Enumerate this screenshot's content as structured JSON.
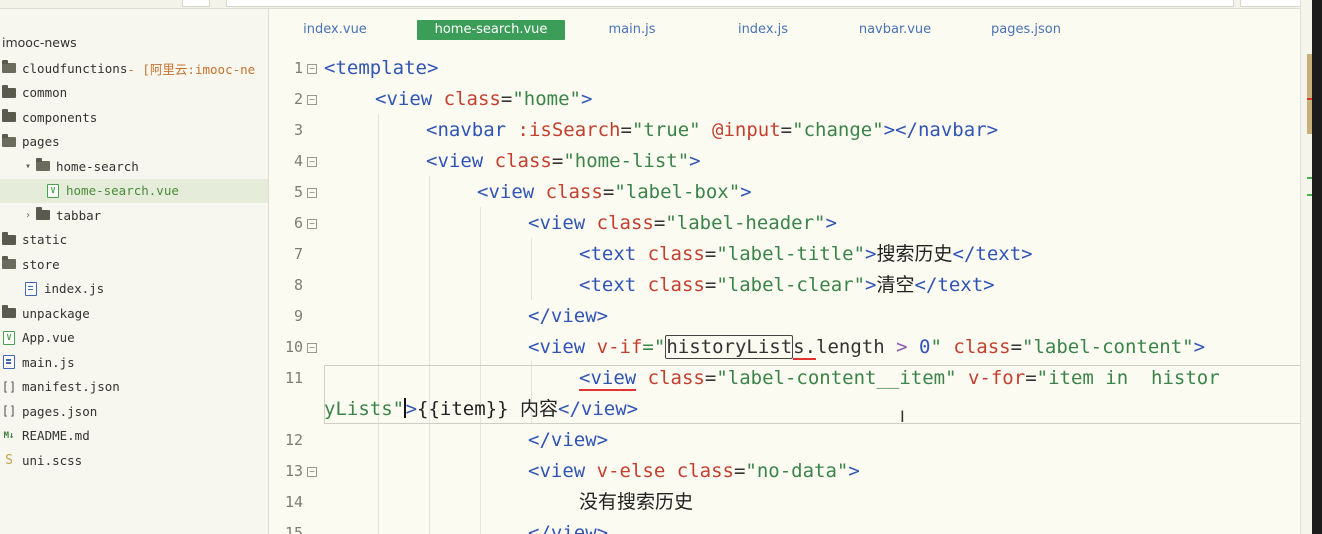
{
  "sidebar": {
    "root": "imooc-news",
    "items": [
      {
        "label": "cloudfunctions",
        "note": " - [阿里云:imooc-ne",
        "icon": "folder-cloud-icon",
        "indent": 0
      },
      {
        "label": "common",
        "icon": "folder-icon",
        "indent": 0
      },
      {
        "label": "components",
        "icon": "folder-icon",
        "indent": 0
      },
      {
        "label": "pages",
        "icon": "folder-open-icon",
        "indent": 0
      },
      {
        "label": "home-search",
        "icon": "folder-open-icon",
        "indent": 1,
        "chevron": "▾"
      },
      {
        "label": "home-search.vue",
        "icon": "vue-file-icon",
        "indent": 2,
        "selected": true
      },
      {
        "label": "tabbar",
        "icon": "folder-icon",
        "indent": 1,
        "chevron": "›"
      },
      {
        "label": "static",
        "icon": "folder-icon",
        "indent": 0
      },
      {
        "label": "store",
        "icon": "folder-open-icon",
        "indent": 0
      },
      {
        "label": "index.js",
        "icon": "js-file-icon",
        "indent": 1
      },
      {
        "label": "unpackage",
        "icon": "folder-icon",
        "indent": 0
      },
      {
        "label": "App.vue",
        "icon": "vue-file-icon",
        "indent": 0
      },
      {
        "label": "main.js",
        "icon": "js-file-icon",
        "indent": 0
      },
      {
        "label": "manifest.json",
        "icon": "json-file-icon",
        "indent": 0
      },
      {
        "label": "pages.json",
        "icon": "json-file-icon",
        "indent": 0
      },
      {
        "label": "README.md",
        "icon": "markdown-file-icon",
        "indent": 0
      },
      {
        "label": "uni.scss",
        "icon": "scss-file-icon",
        "indent": 0
      }
    ]
  },
  "tabs": [
    {
      "label": "index.vue",
      "active": false
    },
    {
      "label": "home-search.vue",
      "active": true
    },
    {
      "label": "main.js",
      "active": false
    },
    {
      "label": "index.js",
      "active": false
    },
    {
      "label": "navbar.vue",
      "active": false
    },
    {
      "label": "pages.json",
      "active": false
    }
  ],
  "editor": {
    "line_numbers": [
      "1",
      "2",
      "3",
      "4",
      "5",
      "6",
      "7",
      "8",
      "9",
      "10",
      "11",
      "12",
      "13",
      "14",
      "15"
    ],
    "l1": {
      "open": "<template>"
    },
    "l2": {
      "open": "<view",
      "attr": "class",
      "eq": "=",
      "val": "\"home\"",
      "close": ">"
    },
    "l3": {
      "open": "<navbar",
      "attr1": ":isSearch",
      "val1": "\"true\"",
      "attr2": "@input",
      "val2": "\"change\"",
      "close": "></navbar>"
    },
    "l4": {
      "open": "<view",
      "attr": "class",
      "val": "\"home-list\"",
      "close": ">"
    },
    "l5": {
      "open": "<view",
      "attr": "class",
      "val": "\"label-box\"",
      "close": ">"
    },
    "l6": {
      "open": "<view",
      "attr": "class",
      "val": "\"label-header\"",
      "close": ">"
    },
    "l7": {
      "open": "<text",
      "attr": "class",
      "val": "\"label-title\"",
      "gt": ">",
      "text": "搜索历史",
      "close": "</text>"
    },
    "l8": {
      "open": "<text",
      "attr": "class",
      "val": "\"label-clear\"",
      "gt": ">",
      "text": "清空",
      "close": "</text>"
    },
    "l9": {
      "close": "</view>"
    },
    "l10": {
      "open": "<view",
      "attr1": "v-if",
      "q": "=\"",
      "boxed": "historyList",
      "squig": "s.",
      "rest": "length ",
      "op": ">",
      "num": " 0",
      "q2": "\"",
      "attr2": "class",
      "val2": "\"label-content\"",
      "close": ">"
    },
    "l11": {
      "open": "<view",
      "attr1": "class",
      "val1": "\"label-content__item\"",
      "attr2": "v-for",
      "val2": "\"item in  histor"
    },
    "l11b": {
      "val": "yLists",
      "q": "\"",
      "gt": ">",
      "text": "{{item}} 内容",
      "close": "</view>"
    },
    "l12": {
      "close": "</view>"
    },
    "l13": {
      "open": "<view",
      "attr1": "v-else",
      "attr2": "class",
      "val2": "\"no-data\"",
      "close": ">"
    },
    "l14": {
      "text": "没有搜索历史"
    },
    "l15": {
      "close": "</view>"
    }
  },
  "colors": {
    "tag": "#3054b6",
    "attr": "#c43f2e",
    "value": "#3b8449",
    "active_tab": "#3b9d58"
  }
}
